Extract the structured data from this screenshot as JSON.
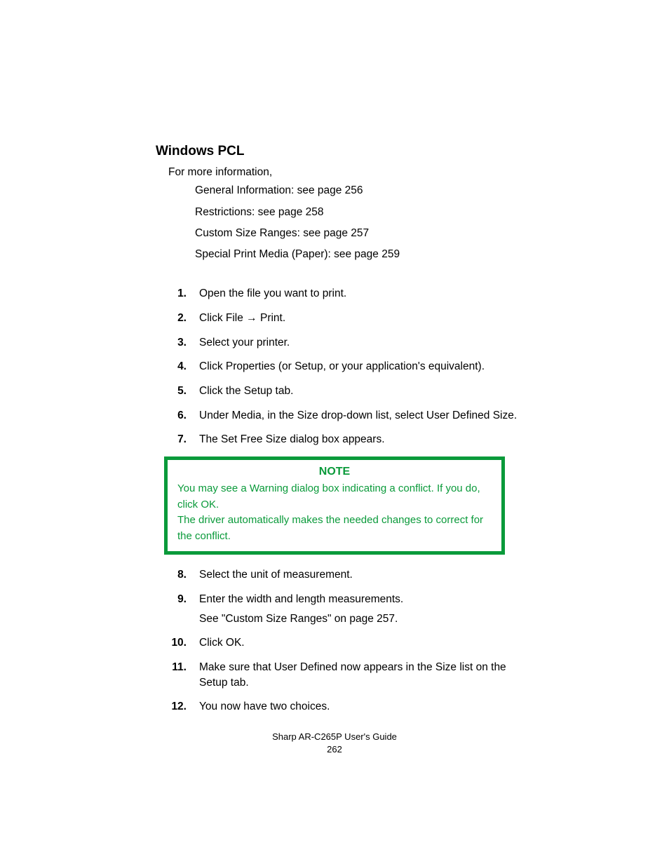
{
  "heading": "Windows PCL",
  "intro": "For more information,",
  "intro_items": [
    "General Information:  see page 256",
    "Restrictions:  see page 258",
    "Custom Size Ranges:  see page 257",
    "Special Print Media (Paper):  see page 259"
  ],
  "steps_a": [
    {
      "n": "1.",
      "t": "Open the file you want to print."
    },
    {
      "n": "2.",
      "t": "Click File  →   Print."
    },
    {
      "n": "3.",
      "t": "Select your printer."
    },
    {
      "n": "4.",
      "t": "Click Properties (or Setup, or your application's equivalent)."
    },
    {
      "n": "5.",
      "t": "Click the Setup tab."
    },
    {
      "n": "6.",
      "t": "Under Media, in the Size drop-down list, select User Defined Size."
    },
    {
      "n": "7.",
      "t": "The Set Free Size dialog box appears."
    }
  ],
  "note": {
    "title": "NOTE",
    "line1": "You may see a Warning dialog box indicating a conflict. If you do, click OK.",
    "line2": "The driver automatically makes the needed changes to correct for the conflict."
  },
  "steps_b": [
    {
      "n": "8.",
      "t": "Select the unit of measurement."
    },
    {
      "n": "9.",
      "t": "Enter the width and length measurements.",
      "sub": "See \"Custom Size Ranges\" on page 257."
    },
    {
      "n": "10.",
      "t": "Click OK."
    },
    {
      "n": "11.",
      "t": "Make sure that User Defined now appears in the Size list on the Setup tab."
    },
    {
      "n": "12.",
      "t": "You now have two choices."
    }
  ],
  "footer": {
    "title": "Sharp AR-C265P User's Guide",
    "page": "262"
  }
}
